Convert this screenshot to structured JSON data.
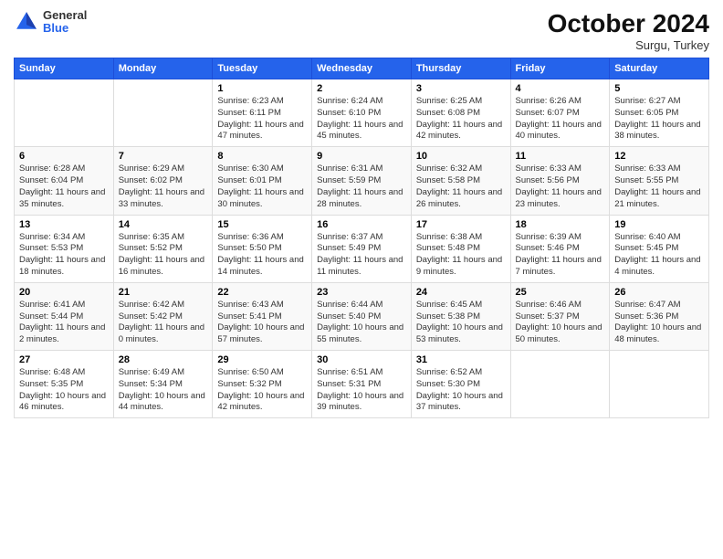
{
  "header": {
    "logo": {
      "general": "General",
      "blue": "Blue"
    },
    "title": "October 2024",
    "subtitle": "Surgu, Turkey"
  },
  "days_of_week": [
    "Sunday",
    "Monday",
    "Tuesday",
    "Wednesday",
    "Thursday",
    "Friday",
    "Saturday"
  ],
  "weeks": [
    [
      {
        "day": "",
        "info": ""
      },
      {
        "day": "",
        "info": ""
      },
      {
        "day": "1",
        "info": "Sunrise: 6:23 AM\nSunset: 6:11 PM\nDaylight: 11 hours and 47 minutes."
      },
      {
        "day": "2",
        "info": "Sunrise: 6:24 AM\nSunset: 6:10 PM\nDaylight: 11 hours and 45 minutes."
      },
      {
        "day": "3",
        "info": "Sunrise: 6:25 AM\nSunset: 6:08 PM\nDaylight: 11 hours and 42 minutes."
      },
      {
        "day": "4",
        "info": "Sunrise: 6:26 AM\nSunset: 6:07 PM\nDaylight: 11 hours and 40 minutes."
      },
      {
        "day": "5",
        "info": "Sunrise: 6:27 AM\nSunset: 6:05 PM\nDaylight: 11 hours and 38 minutes."
      }
    ],
    [
      {
        "day": "6",
        "info": "Sunrise: 6:28 AM\nSunset: 6:04 PM\nDaylight: 11 hours and 35 minutes."
      },
      {
        "day": "7",
        "info": "Sunrise: 6:29 AM\nSunset: 6:02 PM\nDaylight: 11 hours and 33 minutes."
      },
      {
        "day": "8",
        "info": "Sunrise: 6:30 AM\nSunset: 6:01 PM\nDaylight: 11 hours and 30 minutes."
      },
      {
        "day": "9",
        "info": "Sunrise: 6:31 AM\nSunset: 5:59 PM\nDaylight: 11 hours and 28 minutes."
      },
      {
        "day": "10",
        "info": "Sunrise: 6:32 AM\nSunset: 5:58 PM\nDaylight: 11 hours and 26 minutes."
      },
      {
        "day": "11",
        "info": "Sunrise: 6:33 AM\nSunset: 5:56 PM\nDaylight: 11 hours and 23 minutes."
      },
      {
        "day": "12",
        "info": "Sunrise: 6:33 AM\nSunset: 5:55 PM\nDaylight: 11 hours and 21 minutes."
      }
    ],
    [
      {
        "day": "13",
        "info": "Sunrise: 6:34 AM\nSunset: 5:53 PM\nDaylight: 11 hours and 18 minutes."
      },
      {
        "day": "14",
        "info": "Sunrise: 6:35 AM\nSunset: 5:52 PM\nDaylight: 11 hours and 16 minutes."
      },
      {
        "day": "15",
        "info": "Sunrise: 6:36 AM\nSunset: 5:50 PM\nDaylight: 11 hours and 14 minutes."
      },
      {
        "day": "16",
        "info": "Sunrise: 6:37 AM\nSunset: 5:49 PM\nDaylight: 11 hours and 11 minutes."
      },
      {
        "day": "17",
        "info": "Sunrise: 6:38 AM\nSunset: 5:48 PM\nDaylight: 11 hours and 9 minutes."
      },
      {
        "day": "18",
        "info": "Sunrise: 6:39 AM\nSunset: 5:46 PM\nDaylight: 11 hours and 7 minutes."
      },
      {
        "day": "19",
        "info": "Sunrise: 6:40 AM\nSunset: 5:45 PM\nDaylight: 11 hours and 4 minutes."
      }
    ],
    [
      {
        "day": "20",
        "info": "Sunrise: 6:41 AM\nSunset: 5:44 PM\nDaylight: 11 hours and 2 minutes."
      },
      {
        "day": "21",
        "info": "Sunrise: 6:42 AM\nSunset: 5:42 PM\nDaylight: 11 hours and 0 minutes."
      },
      {
        "day": "22",
        "info": "Sunrise: 6:43 AM\nSunset: 5:41 PM\nDaylight: 10 hours and 57 minutes."
      },
      {
        "day": "23",
        "info": "Sunrise: 6:44 AM\nSunset: 5:40 PM\nDaylight: 10 hours and 55 minutes."
      },
      {
        "day": "24",
        "info": "Sunrise: 6:45 AM\nSunset: 5:38 PM\nDaylight: 10 hours and 53 minutes."
      },
      {
        "day": "25",
        "info": "Sunrise: 6:46 AM\nSunset: 5:37 PM\nDaylight: 10 hours and 50 minutes."
      },
      {
        "day": "26",
        "info": "Sunrise: 6:47 AM\nSunset: 5:36 PM\nDaylight: 10 hours and 48 minutes."
      }
    ],
    [
      {
        "day": "27",
        "info": "Sunrise: 6:48 AM\nSunset: 5:35 PM\nDaylight: 10 hours and 46 minutes."
      },
      {
        "day": "28",
        "info": "Sunrise: 6:49 AM\nSunset: 5:34 PM\nDaylight: 10 hours and 44 minutes."
      },
      {
        "day": "29",
        "info": "Sunrise: 6:50 AM\nSunset: 5:32 PM\nDaylight: 10 hours and 42 minutes."
      },
      {
        "day": "30",
        "info": "Sunrise: 6:51 AM\nSunset: 5:31 PM\nDaylight: 10 hours and 39 minutes."
      },
      {
        "day": "31",
        "info": "Sunrise: 6:52 AM\nSunset: 5:30 PM\nDaylight: 10 hours and 37 minutes."
      },
      {
        "day": "",
        "info": ""
      },
      {
        "day": "",
        "info": ""
      }
    ]
  ]
}
